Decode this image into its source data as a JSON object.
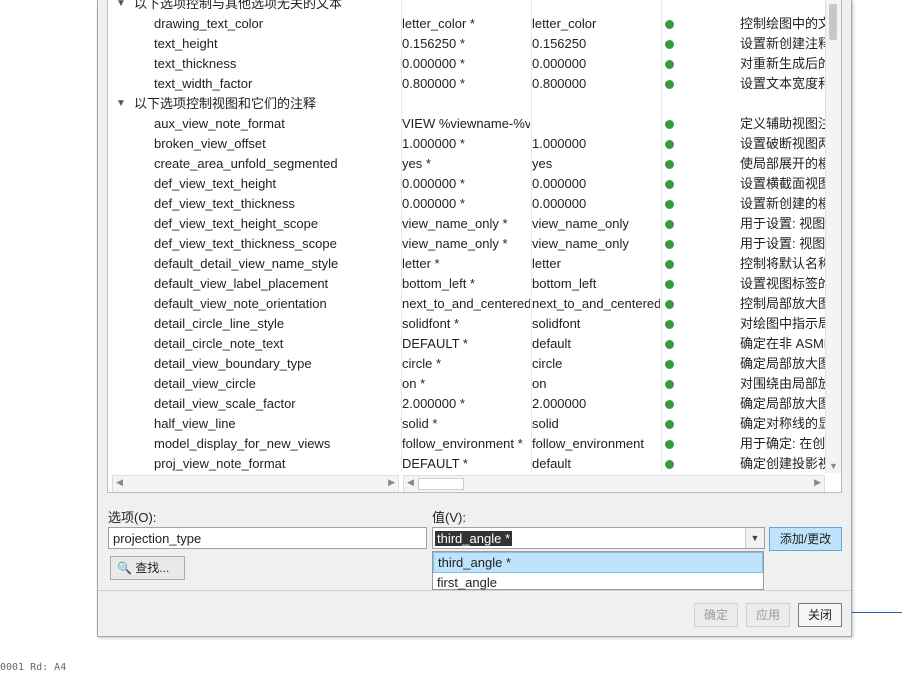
{
  "table": {
    "rows": [
      {
        "kind": "group",
        "label": "以下选项控制与其他选项无关的文本"
      },
      {
        "kind": "item",
        "name": "drawing_text_color",
        "value": "letter_color *",
        "default": "letter_color",
        "desc": "控制绘图中的文"
      },
      {
        "kind": "item",
        "name": "text_height",
        "value": "0.156250 *",
        "default": "0.156250",
        "desc": "设置新创建注释"
      },
      {
        "kind": "item",
        "name": "text_thickness",
        "value": "0.000000 *",
        "default": "0.000000",
        "desc": "对重新生成后的"
      },
      {
        "kind": "item",
        "name": "text_width_factor",
        "value": "0.800000 *",
        "default": "0.800000",
        "desc": "设置文本宽度和"
      },
      {
        "kind": "group",
        "label": "以下选项控制视图和它们的注释"
      },
      {
        "kind": "item",
        "name": "aux_view_note_format",
        "value": "VIEW %viewname-%vi",
        "default": "",
        "desc": "定义辅助视图注"
      },
      {
        "kind": "item",
        "name": "broken_view_offset",
        "value": "1.000000 *",
        "default": "1.000000",
        "desc": "设置破断视图两"
      },
      {
        "kind": "item",
        "name": "create_area_unfold_segmented",
        "value": "yes *",
        "default": "yes",
        "desc": "使局部展开的横"
      },
      {
        "kind": "item",
        "name": "def_view_text_height",
        "value": "0.000000 *",
        "default": "0.000000",
        "desc": "设置横截面视图"
      },
      {
        "kind": "item",
        "name": "def_view_text_thickness",
        "value": "0.000000 *",
        "default": "0.000000",
        "desc": "设置新创建的横"
      },
      {
        "kind": "item",
        "name": "def_view_text_height_scope",
        "value": "view_name_only *",
        "default": "view_name_only",
        "desc": "用于设置: 视图文"
      },
      {
        "kind": "item",
        "name": "def_view_text_thickness_scope",
        "value": "view_name_only *",
        "default": "view_name_only",
        "desc": "用于设置: 视图文"
      },
      {
        "kind": "item",
        "name": "default_detail_view_name_style",
        "value": "letter *",
        "default": "letter",
        "desc": "控制将默认名称"
      },
      {
        "kind": "item",
        "name": "default_view_label_placement",
        "value": "bottom_left *",
        "default": "bottom_left",
        "desc": "设置视图标签的"
      },
      {
        "kind": "item",
        "name": "default_view_note_orientation",
        "value": "next_to_and_centered",
        "default": "next_to_and_centered_",
        "desc": "控制局部放大图"
      },
      {
        "kind": "item",
        "name": "detail_circle_line_style",
        "value": "solidfont *",
        "default": "solidfont",
        "desc": "对绘图中指示局"
      },
      {
        "kind": "item",
        "name": "detail_circle_note_text",
        "value": "DEFAULT *",
        "default": "default",
        "desc": "确定在非 ASME"
      },
      {
        "kind": "item",
        "name": "detail_view_boundary_type",
        "value": "circle *",
        "default": "circle",
        "desc": "确定局部放大图"
      },
      {
        "kind": "item",
        "name": "detail_view_circle",
        "value": "on *",
        "default": "on",
        "desc": "对围绕由局部放"
      },
      {
        "kind": "item",
        "name": "detail_view_scale_factor",
        "value": "2.000000 *",
        "default": "2.000000",
        "desc": "确定局部放大图"
      },
      {
        "kind": "item",
        "name": "half_view_line",
        "value": "solid *",
        "default": "solid",
        "desc": "确定对称线的显"
      },
      {
        "kind": "item",
        "name": "model_display_for_new_views",
        "value": "follow_environment *",
        "default": "follow_environment",
        "desc": "用于确定: 在创建"
      },
      {
        "kind": "item",
        "name": "proj_view_note_format",
        "value": "DEFAULT *",
        "default": "default",
        "desc": "确定创建投影视"
      }
    ]
  },
  "option": {
    "label": "选项(O):",
    "value": "projection_type"
  },
  "value": {
    "label": "值(V):",
    "current": "third_angle *",
    "options": [
      "third_angle *",
      "first_angle"
    ]
  },
  "buttons": {
    "find": "查找...",
    "add_change": "添加/更改",
    "ok": "确定",
    "apply": "应用",
    "close": "关闭"
  },
  "background_text": "0001 Rd: A4",
  "status_dot_color": "#3a9a3a"
}
